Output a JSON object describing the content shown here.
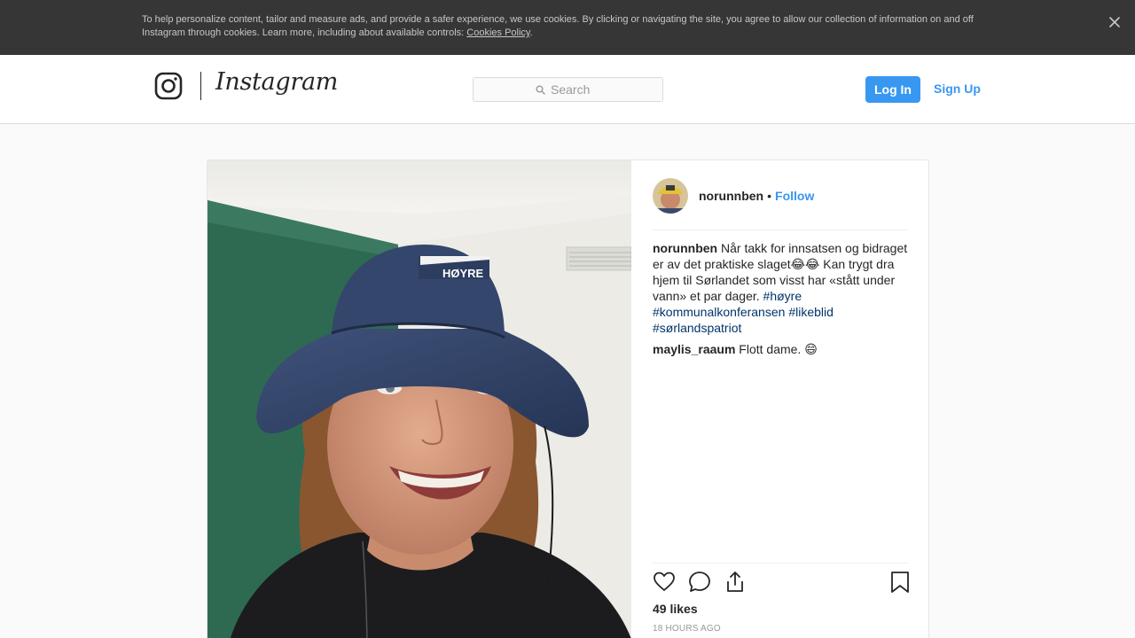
{
  "cookie_banner": {
    "text": "To help personalize content, tailor and measure ads, and provide a safer experience, we use cookies. By clicking or navigating the site, you agree to allow our collection of information on and off Instagram through cookies. Learn more, including about available controls: ",
    "link_text": "Cookies Policy",
    "trailing": "."
  },
  "header": {
    "brand": "Instagram",
    "search_placeholder": "Search",
    "login_label": "Log In",
    "signup_label": "Sign Up"
  },
  "post": {
    "username": "norunnben",
    "separator": "•",
    "follow_label": "Follow",
    "caption_user": "norunnben",
    "caption_text": "Når takk for innsatsen og bidraget er av det praktiske slaget😂😂 Kan trygt dra hjem til Sørlandet som visst har «stått under vann» et par dager.",
    "hashtags": [
      "#høyre",
      "#kommunalkonferansen",
      "#likeblid",
      "#sørlandspatriot"
    ],
    "comments": [
      {
        "user": "maylis_raaum",
        "text": "Flott dame. 😄"
      }
    ],
    "likes": "49 likes",
    "timestamp": "18 HOURS AGO",
    "hat_text": "HØYRE"
  },
  "icons": {
    "cookie_close": "close-icon",
    "logo": "instagram-glyph-icon",
    "search": "search-icon",
    "like": "heart-icon",
    "comment": "comment-icon",
    "share": "share-icon",
    "save": "bookmark-icon"
  },
  "colors": {
    "accent": "#3897f0",
    "hashtag": "#003569",
    "banner_bg": "#363636",
    "page_bg": "#fafafa"
  }
}
